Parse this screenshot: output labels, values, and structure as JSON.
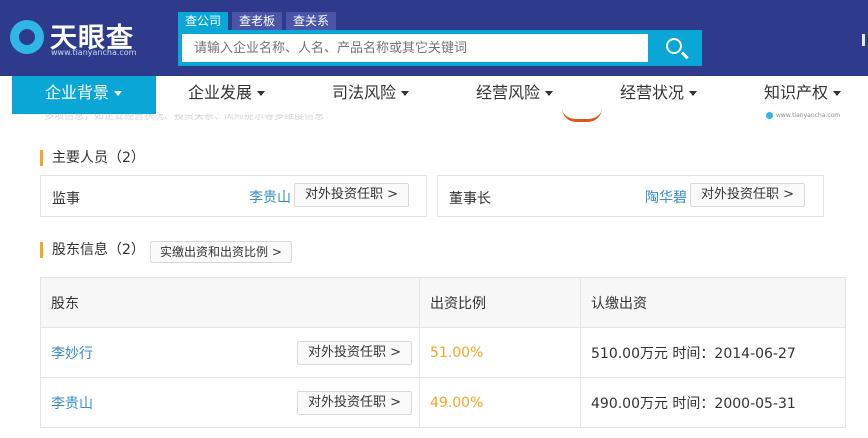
{
  "brand": {
    "name": "天眼查",
    "domain": "www.tianyancha.com"
  },
  "search": {
    "tabs": [
      "查公司",
      "查老板",
      "查关系"
    ],
    "placeholder": "请输入企业名称、人名、产品名称或其它关键词"
  },
  "nav": {
    "items": [
      "企业背景",
      "企业发展",
      "司法风险",
      "经营风险",
      "经营状况",
      "知识产权"
    ],
    "active": "企业背景"
  },
  "ghost": {
    "text": "多项信息，如企业经营状况、投资关系、风险提示等多维度信息",
    "logo_text": "www.tianyancha.com"
  },
  "personnel": {
    "title": "主要人员（2）",
    "members": [
      {
        "role": "监事",
        "name": "李贵山",
        "action": "对外投资任职 >"
      },
      {
        "role": "董事长",
        "name": "陶华碧",
        "action": "对外投资任职 >"
      }
    ]
  },
  "shareholders": {
    "title": "股东信息（2）",
    "ratio_button": "实缴出资和出资比例 >",
    "headers": [
      "股东",
      "出资比例",
      "认缴出资"
    ],
    "rows": [
      {
        "name": "李妙行",
        "action": "对外投资任职 >",
        "ratio": "51.00%",
        "subscribed": "510.00万元 时间：2014-06-27"
      },
      {
        "name": "李贵山",
        "action": "对外投资任职 >",
        "ratio": "49.00%",
        "subscribed": "490.00万元 时间：2000-05-31"
      }
    ]
  },
  "colors": {
    "header_bg": "#2e3a8c",
    "accent": "#0aa7d6",
    "link": "#3a8dc9",
    "percent": "#f5a623"
  }
}
